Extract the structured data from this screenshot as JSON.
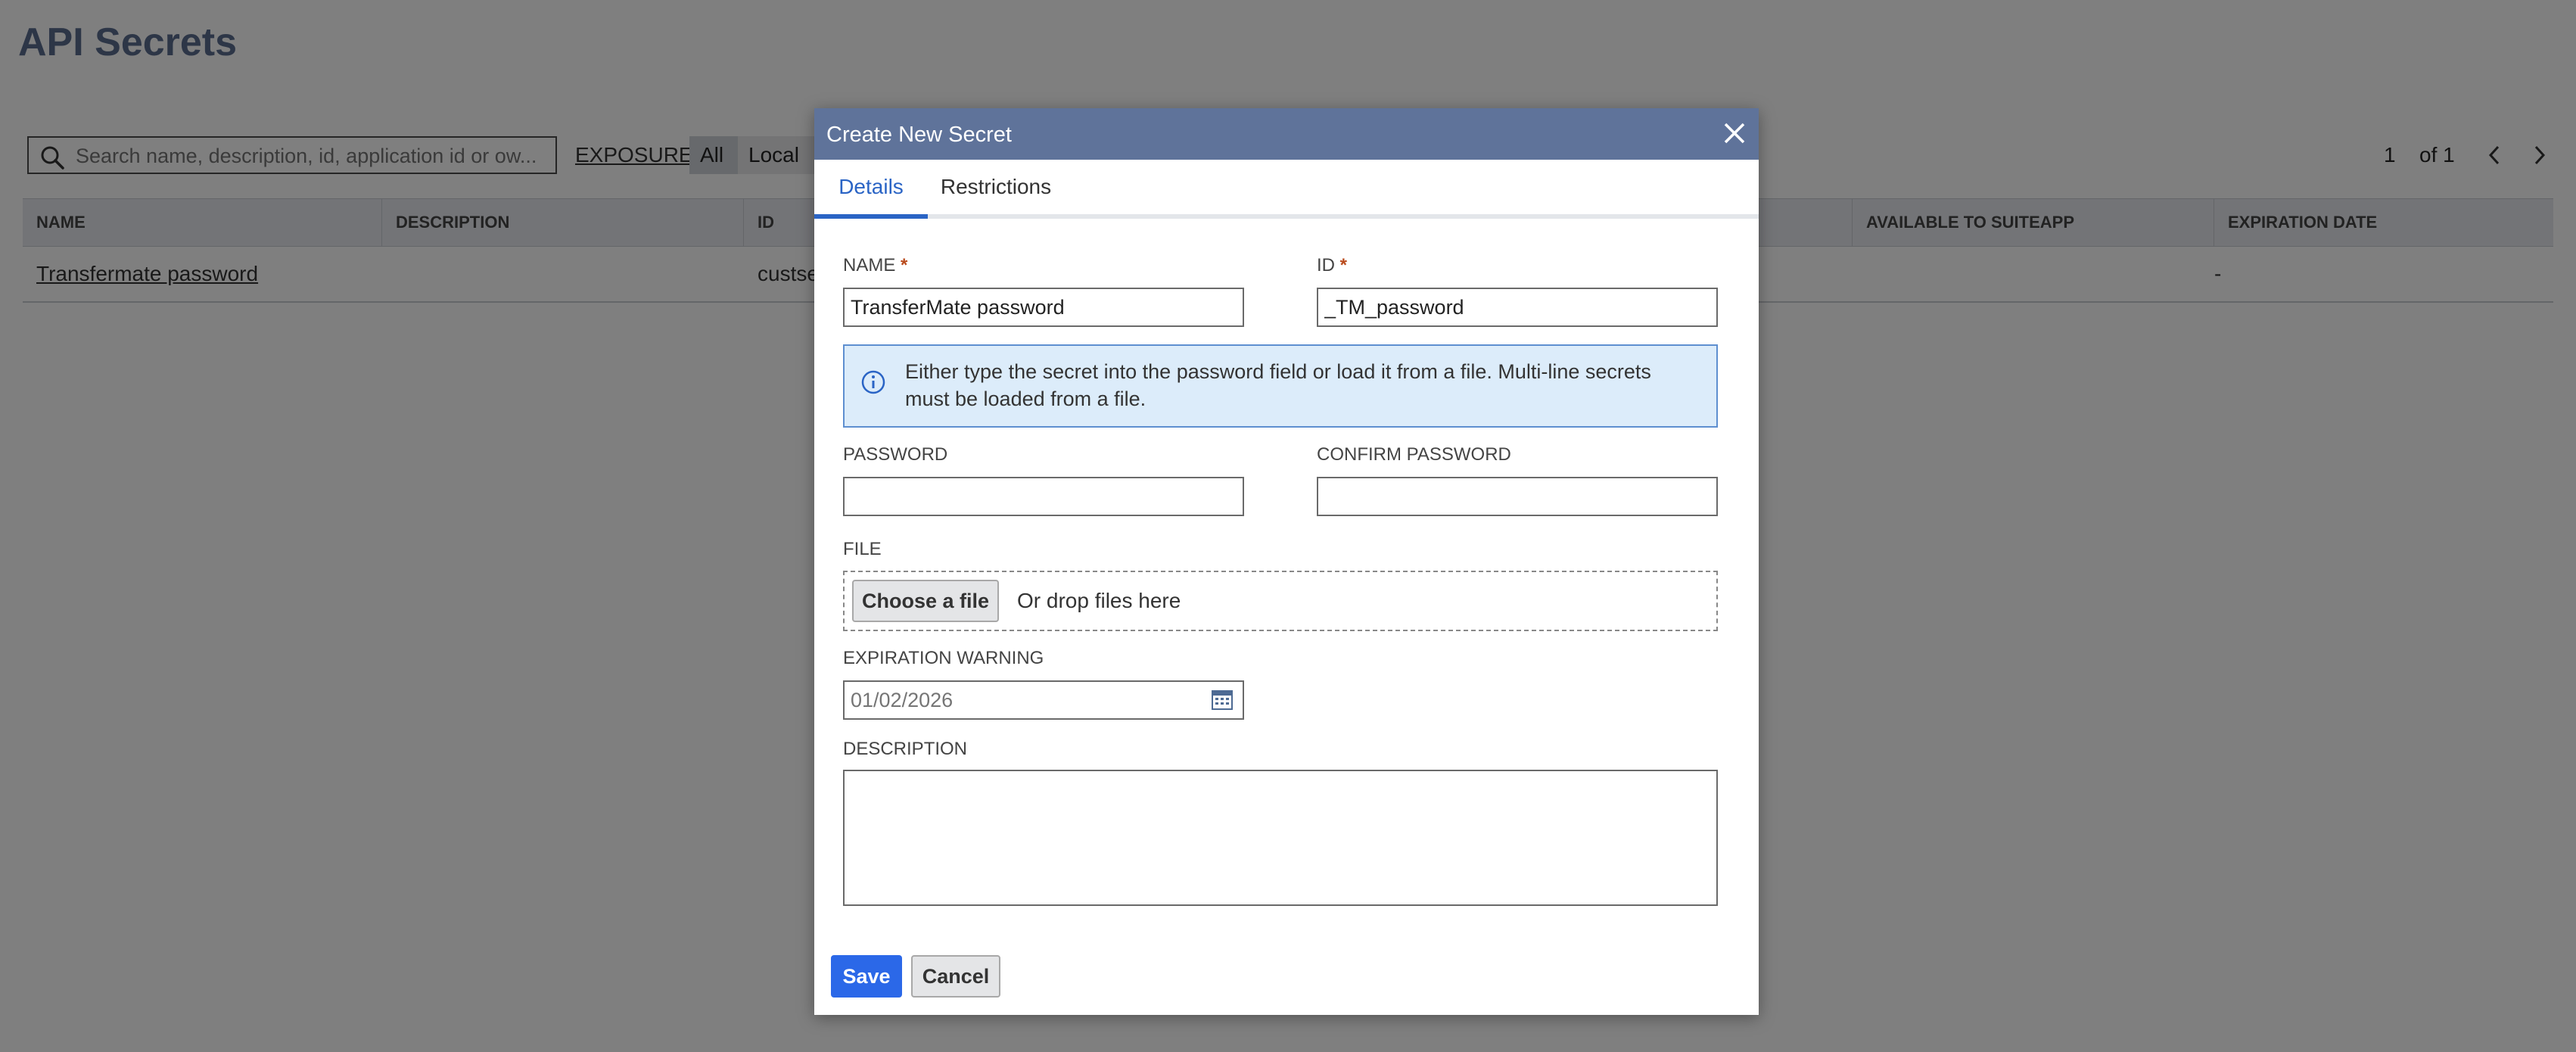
{
  "page": {
    "title": "API Secrets",
    "search": {
      "placeholder": "Search name, description, id, application id or ow..."
    },
    "exposure": {
      "label": "EXPOSURE",
      "options": [
        "All",
        "Local"
      ],
      "selected": "All"
    },
    "pager": {
      "current": "1",
      "of": "of 1"
    },
    "table": {
      "columns": [
        "NAME",
        "DESCRIPTION",
        "ID",
        "AVAILABLE TO SUITEAPP",
        "EXPIRATION DATE"
      ],
      "rows": [
        {
          "name": "Transfermate password",
          "description": "",
          "id": "custse",
          "available": "",
          "expiration": "-"
        }
      ]
    }
  },
  "modal": {
    "title": "Create New Secret",
    "tabs": [
      "Details",
      "Restrictions"
    ],
    "active_tab": "Details",
    "fields": {
      "name": {
        "label": "NAME",
        "required_mark": "*",
        "value": "TransferMate password"
      },
      "id": {
        "label": "ID",
        "required_mark": "*",
        "value": "_TM_password"
      },
      "info": "Either type the secret into the password field or load it from a file. Multi-line secrets must be loaded from a file.",
      "password": {
        "label": "PASSWORD",
        "value": ""
      },
      "confirm_password": {
        "label": "CONFIRM PASSWORD",
        "value": ""
      },
      "file": {
        "label": "FILE",
        "button": "Choose a file",
        "drop_text": "Or drop files here"
      },
      "expiration_warning": {
        "label": "EXPIRATION WARNING",
        "placeholder": "01/02/2026"
      },
      "description": {
        "label": "DESCRIPTION",
        "value": ""
      }
    },
    "buttons": {
      "save": "Save",
      "cancel": "Cancel"
    }
  },
  "colors": {
    "header": "#5f739a",
    "accent": "#2b68e8",
    "tab_active": "#2a64c5",
    "info_bg": "#dcecfa",
    "required": "#b94a1c"
  },
  "icons": [
    "search-icon",
    "close-icon",
    "chevron-left-icon",
    "chevron-right-icon",
    "info-icon",
    "calendar-icon"
  ]
}
